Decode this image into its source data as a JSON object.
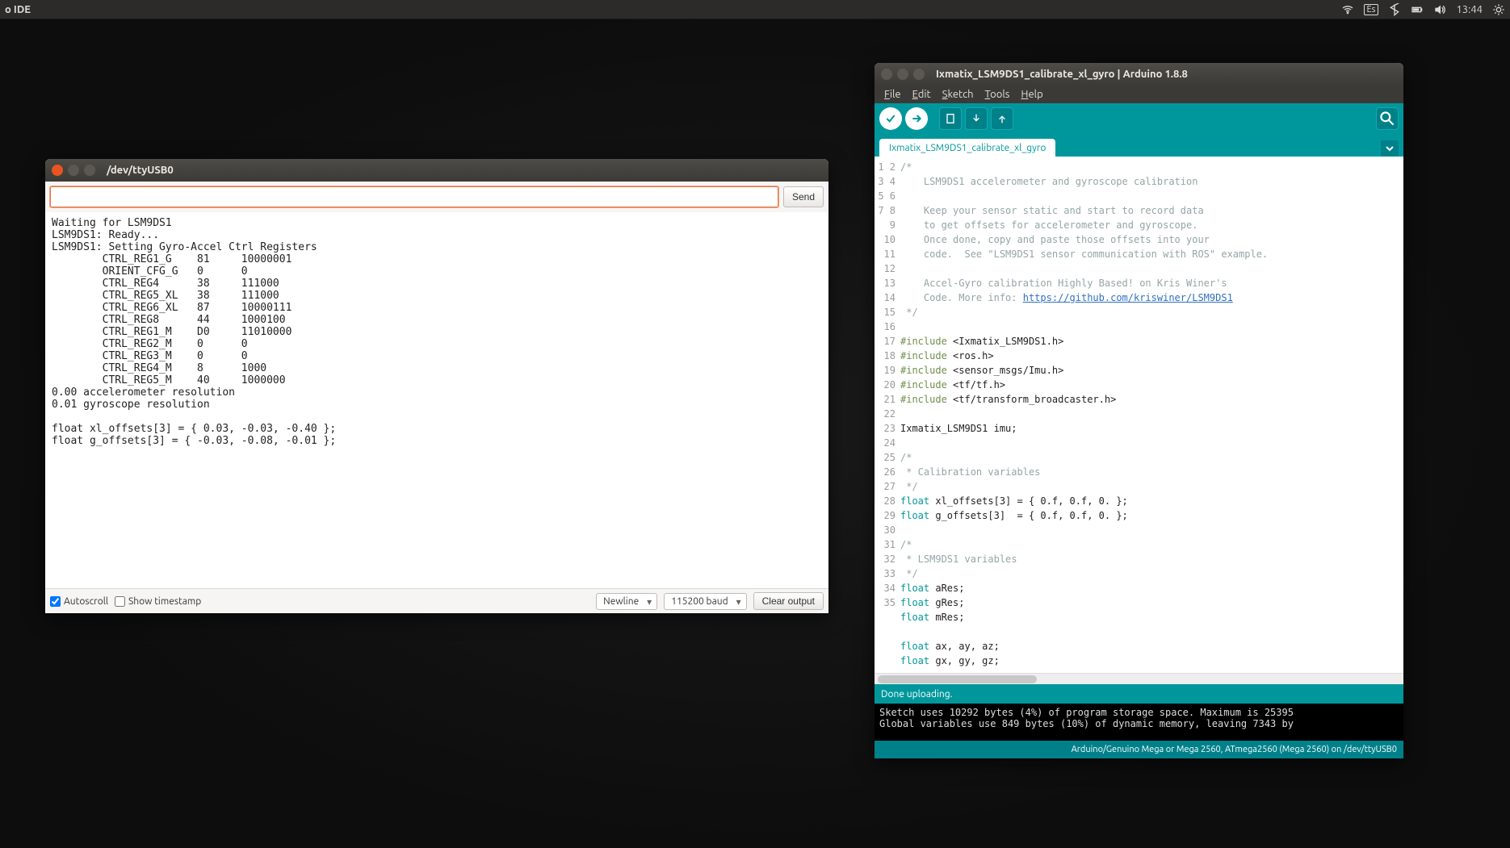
{
  "topbar": {
    "app_label": "o IDE",
    "lang_badge": "Es",
    "clock": "13:44"
  },
  "serial": {
    "title": "/dev/ttyUSB0",
    "send_label": "Send",
    "autoscroll_label": "Autoscroll",
    "show_ts_label": "Show timestamp",
    "line_ending": "Newline",
    "baud": "115200 baud",
    "clear_label": "Clear output",
    "body": "Waiting for LSM9DS1\nLSM9DS1: Ready...\nLSM9DS1: Setting Gyro-Accel Ctrl Registers\n        CTRL_REG1_G    81     10000001\n        ORIENT_CFG_G   0      0\n        CTRL_REG4      38     111000\n        CTRL_REG5_XL   38     111000\n        CTRL_REG6_XL   87     10000111\n        CTRL_REG8      44     1000100\n        CTRL_REG1_M    D0     11010000\n        CTRL_REG2_M    0      0\n        CTRL_REG3_M    0      0\n        CTRL_REG4_M    8      1000\n        CTRL_REG5_M    40     1000000\n0.00 accelerometer resolution\n0.01 gyroscope resolution\n\nfloat xl_offsets[3] = { 0.03, -0.03, -0.40 };\nfloat g_offsets[3] = { -0.03, -0.08, -0.01 };"
  },
  "ide": {
    "title": "Ixmatix_LSM9DS1_calibrate_xl_gyro | Arduino 1.8.8",
    "menus": {
      "file": "File",
      "edit": "Edit",
      "sketch": "Sketch",
      "tools": "Tools",
      "help": "Help"
    },
    "tab_label": "Ixmatix_LSM9DS1_calibrate_xl_gyro",
    "status": "Done uploading.",
    "console_line1": "Sketch uses 10292 bytes (4%) of program storage space. Maximum is 25395",
    "console_line2": "Global variables use 849 bytes (10%) of dynamic memory, leaving 7343 by",
    "footer": "Arduino/Genuino Mega or Mega 2560, ATmega2560 (Mega 2560) on /dev/ttyUSB0",
    "code": {
      "l1": "/*",
      "l2": "    LSM9DS1 accelerometer and gyroscope calibration",
      "l3": "",
      "l4": "    Keep your sensor static and start to record data",
      "l5": "    to get offsets for accelerometer and gyroscope.",
      "l6": "    Once done, copy and paste those offsets into your",
      "l7": "    code.  See \"LSM9DS1 sensor communication with ROS\" example.",
      "l8": "",
      "l9": "    Accel-Gyro calibration Highly Based! on Kris Winer's",
      "l10a": "    Code. More info: ",
      "l10b": "https://github.com/kriswiner/LSM9DS1",
      "l11": " */",
      "inc": "#include",
      "h13": " <Ixmatix_LSM9DS1.h>",
      "h14": " <ros.h>",
      "h15": " <sensor_msgs/Imu.h>",
      "h16": " <tf/tf.h>",
      "h17": " <tf/transform_broadcaster.h>",
      "l19": "Ixmatix_LSM9DS1 imu;",
      "l21": "/*",
      "l22": " * Calibration variables",
      "l23": " */",
      "flt": "float",
      "l24b": " xl_offsets[3] = { 0.f, 0.f, 0. };",
      "l25b": " g_offsets[3]  = { 0.f, 0.f, 0. };",
      "l27": "/*",
      "l28": " * LSM9DS1 variables",
      "l29": " */",
      "l30b": " aRes;",
      "l31b": " gRes;",
      "l32b": " mRes;",
      "l34b": " ax, ay, az;",
      "l35b": " gx, gy, gz;"
    }
  }
}
